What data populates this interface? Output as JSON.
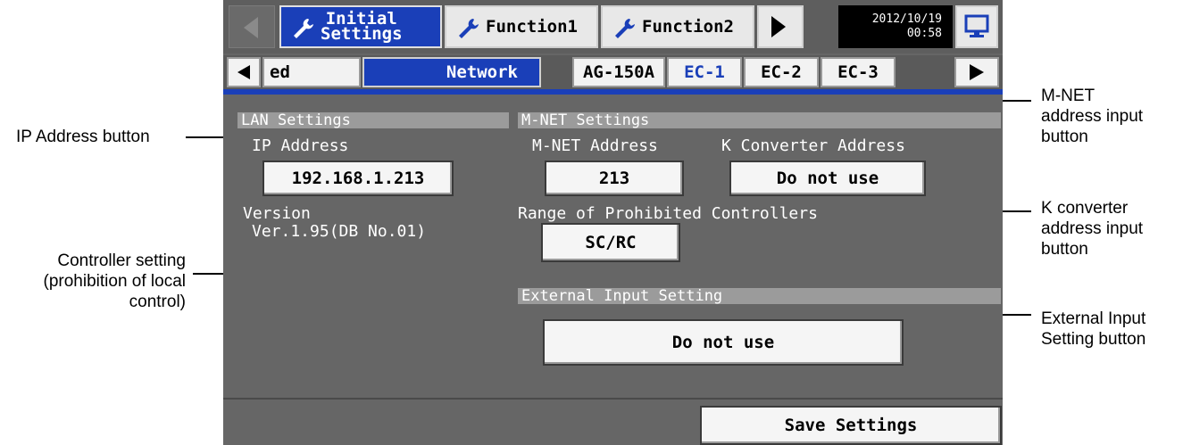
{
  "annotations": {
    "ip_address_button": "IP Address button",
    "controller_setting": [
      "Controller setting",
      "(prohibition of local",
      "control)"
    ],
    "mnet_address": [
      "M-NET",
      "address input",
      "button"
    ],
    "k_converter": [
      "K converter",
      "address input",
      "button"
    ],
    "external_input": [
      "External Input",
      "Setting button"
    ]
  },
  "topbar": {
    "tabs": [
      {
        "label": "Initial\nSettings",
        "active": true
      },
      {
        "label": "Function1",
        "active": false
      },
      {
        "label": "Function2",
        "active": false
      }
    ],
    "date": "2012/10/19",
    "time": "00:58"
  },
  "subtabs": {
    "partial_left": "ed",
    "items": [
      "Network",
      "AG-150A",
      "EC-1",
      "EC-2",
      "EC-3"
    ],
    "active": "Network"
  },
  "lan": {
    "section_title": "LAN Settings",
    "ip_label": "IP Address",
    "ip_value": "192.168.1.213",
    "version_label": "Version",
    "version_value": "Ver.1.95(DB No.01)"
  },
  "mnet": {
    "section_title": "M-NET Settings",
    "address_label": "M-NET Address",
    "address_value": "213",
    "k_label": "K Converter Address",
    "k_value": "Do not use",
    "range_label": "Range of Prohibited Controllers",
    "range_value": "SC/RC"
  },
  "external": {
    "section_title": "External Input Setting",
    "value": "Do not use"
  },
  "footer": {
    "save_label": "Save Settings"
  },
  "colors": {
    "accent_blue": "#1a3fb8",
    "screen_bg": "#666666",
    "section_bg": "#9b9b9b"
  }
}
